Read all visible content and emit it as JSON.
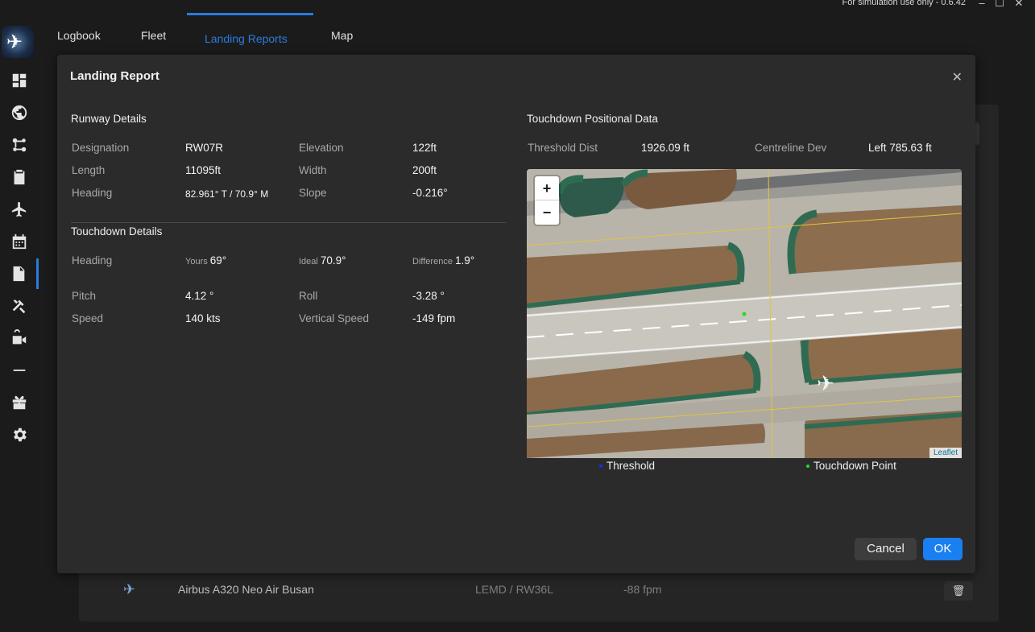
{
  "window": {
    "sim_note": "For simulation use only - 0.6.42",
    "minimize": "–",
    "maximize": "☐",
    "close": "✕"
  },
  "tabs": [
    {
      "label": "Logbook"
    },
    {
      "label": "Fleet"
    },
    {
      "label": "Landing Reports"
    },
    {
      "label": "Map"
    }
  ],
  "background": {
    "row": {
      "aircraft": "Airbus A320 Neo Air Busan",
      "route": "LEMD / RW36L",
      "vertical_speed": "-88 fpm"
    }
  },
  "modal": {
    "title": "Landing Report",
    "runway": {
      "title": "Runway Details",
      "designation_label": "Designation",
      "designation": "RW07R",
      "elevation_label": "Elevation",
      "elevation": "122ft",
      "length_label": "Length",
      "length": "11095ft",
      "width_label": "Width",
      "width": "200ft",
      "heading_label": "Heading",
      "heading": "82.961° T / 70.9° M",
      "slope_label": "Slope",
      "slope": "-0.216°"
    },
    "touchdown": {
      "title": "Touchdown Details",
      "heading_label": "Heading",
      "yours_label": "Yours",
      "yours": "69°",
      "ideal_label": "Ideal",
      "ideal": "70.9°",
      "difference_label": "Difference",
      "difference": "1.9°",
      "pitch_label": "Pitch",
      "pitch": "4.12 °",
      "roll_label": "Roll",
      "roll": "-3.28 °",
      "speed_label": "Speed",
      "speed": "140 kts",
      "vs_label": "Vertical Speed",
      "vs": "-149 fpm"
    },
    "positional": {
      "title": "Touchdown Positional Data",
      "threshold_label": "Threshold Dist",
      "threshold": "1926.09 ft",
      "centreline_label": "Centreline Dev",
      "centreline": "Left 785.63 ft"
    },
    "map": {
      "zoom_in": "+",
      "zoom_out": "−",
      "attribution": "Leaflet",
      "legend_threshold": "Threshold",
      "legend_touchdown": "Touchdown Point",
      "threshold_color": "#1030ff",
      "touchdown_color": "#22dd22"
    },
    "cancel": "Cancel",
    "ok": "OK"
  }
}
